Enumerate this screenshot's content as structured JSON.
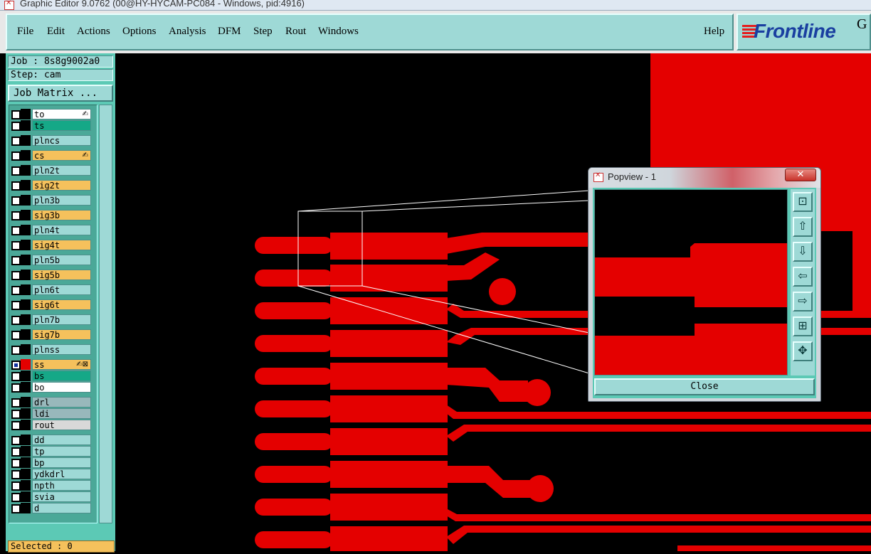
{
  "window": {
    "title": "Graphic Editor 9.0762 (00@HY-HYCAM-PC084 - Windows, pid:4916)"
  },
  "menu": {
    "items": [
      "File",
      "Edit",
      "Actions",
      "Options",
      "Analysis",
      "DFM",
      "Step",
      "Rout",
      "Windows"
    ],
    "help": "Help"
  },
  "logo": {
    "text": "Frontline",
    "trailing": "G"
  },
  "left_panel": {
    "job": "Job : 8s8g9002a0",
    "step": "Step: cam",
    "job_matrix": "Job Matrix ...",
    "selected": "Selected : 0",
    "layers": [
      {
        "name": "to",
        "color": "white",
        "mark": "✍"
      },
      {
        "name": "ts",
        "color": "teal"
      },
      {
        "name": "plncs",
        "color": "cyan"
      },
      {
        "name": "cs",
        "color": "orange",
        "mark": "✍"
      },
      {
        "name": "pln2t",
        "color": "cyan"
      },
      {
        "name": "sig2t",
        "color": "orange"
      },
      {
        "name": "pln3b",
        "color": "cyan"
      },
      {
        "name": "sig3b",
        "color": "orange"
      },
      {
        "name": "pln4t",
        "color": "cyan"
      },
      {
        "name": "sig4t",
        "color": "orange"
      },
      {
        "name": "pln5b",
        "color": "cyan"
      },
      {
        "name": "sig5b",
        "color": "orange"
      },
      {
        "name": "pln6t",
        "color": "cyan"
      },
      {
        "name": "sig6t",
        "color": "orange"
      },
      {
        "name": "pln7b",
        "color": "cyan"
      },
      {
        "name": "sig7b",
        "color": "orange"
      },
      {
        "name": "plnss",
        "color": "cyan"
      },
      {
        "name": "ss",
        "color": "orange",
        "mark": "✍⊠",
        "active": true
      },
      {
        "name": "bs",
        "color": "teal"
      },
      {
        "name": "bo",
        "color": "white"
      },
      {
        "name": "drl",
        "color": "grayblue"
      },
      {
        "name": "ldi",
        "color": "grayblue"
      },
      {
        "name": "rout",
        "color": "lgray"
      },
      {
        "name": "dd",
        "color": "cyan"
      },
      {
        "name": "tp",
        "color": "cyan"
      },
      {
        "name": "bp",
        "color": "cyan"
      },
      {
        "name": "ydkdrl",
        "color": "cyan"
      },
      {
        "name": "npth",
        "color": "cyan"
      },
      {
        "name": "svia",
        "color": "cyan"
      },
      {
        "name": "d",
        "color": "cyan"
      }
    ]
  },
  "popview": {
    "title": "Popview - 1",
    "close_x": "✕",
    "close_button": "Close",
    "tools": [
      {
        "name": "zoom-home-icon",
        "glyph": "⊡"
      },
      {
        "name": "pan-up-icon",
        "glyph": "⇧"
      },
      {
        "name": "pan-down-icon",
        "glyph": "⇩"
      },
      {
        "name": "pan-left-icon",
        "glyph": "⇦"
      },
      {
        "name": "pan-right-icon",
        "glyph": "⇨"
      },
      {
        "name": "zoom-in-icon",
        "glyph": "⊞"
      },
      {
        "name": "zoom-out-icon",
        "glyph": "✥"
      }
    ]
  },
  "colors": {
    "copper": "#e40000",
    "panel": "#9ed9d6",
    "panel_dark": "#5cc9b5",
    "canvas": "#000000"
  }
}
